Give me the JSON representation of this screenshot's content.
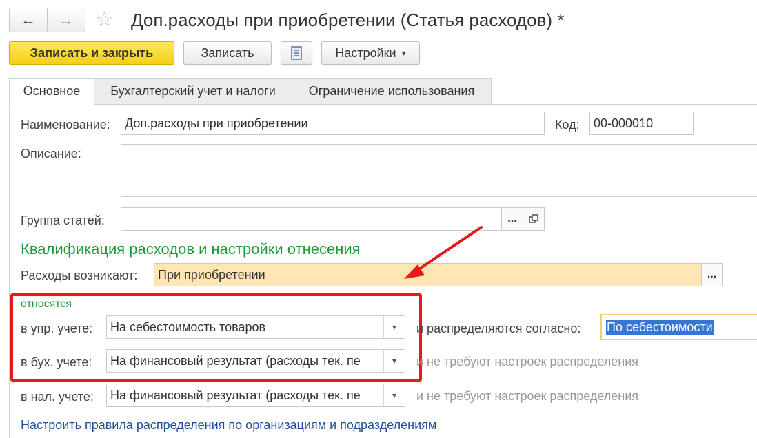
{
  "window": {
    "title": "Доп.расходы при приобретении (Статья расходов) *",
    "nav_back_icon": "arrow-left-icon",
    "nav_forward_icon": "arrow-right-icon",
    "favorite_icon": "star-icon"
  },
  "toolbar": {
    "save_close_label": "Записать и закрыть",
    "save_label": "Записать",
    "settings_label": "Настройки",
    "settings_arrow": "▾"
  },
  "tabs": [
    {
      "label": "Основное",
      "active": true
    },
    {
      "label": "Бухгалтерский учет и налоги",
      "active": false
    },
    {
      "label": "Ограничение использования",
      "active": false
    }
  ],
  "form": {
    "name_label": "Наименование:",
    "name_value": "Доп.расходы при приобретении",
    "code_label": "Код:",
    "code_value": "00-000010",
    "description_label": "Описание:",
    "description_value": "",
    "group_label": "Группа статей:",
    "group_value": "",
    "ellipsis": "...",
    "section_title": "Квалификация расходов и настройки отнесения",
    "arises_label": "Расходы возникают:",
    "arises_value": "При приобретении",
    "relates_label": "относятся",
    "mgmt_label": "в упр. учете:",
    "mgmt_value": "На себестоимость товаров",
    "mgmt_distribution_label": "и распределяются согласно:",
    "mgmt_distribution_value": "По себестоимости",
    "acct_label": "в бух. учете:",
    "acct_value": "На финансовый результат (расходы тек. пе",
    "acct_note": "и не требуют настроек распределения",
    "tax_label": "в нал. учете:",
    "tax_value": "На финансовый результат (расходы тек. пе",
    "tax_note": "и не требуют настроек распределения",
    "configure_link": "Настроить правила распределения по организациям и подразделениям"
  },
  "colors": {
    "accent_green": "#1e9a3a",
    "highlight_field": "#fde6b3",
    "annotation_red": "#e8191b",
    "selection_blue": "#3875d7"
  }
}
